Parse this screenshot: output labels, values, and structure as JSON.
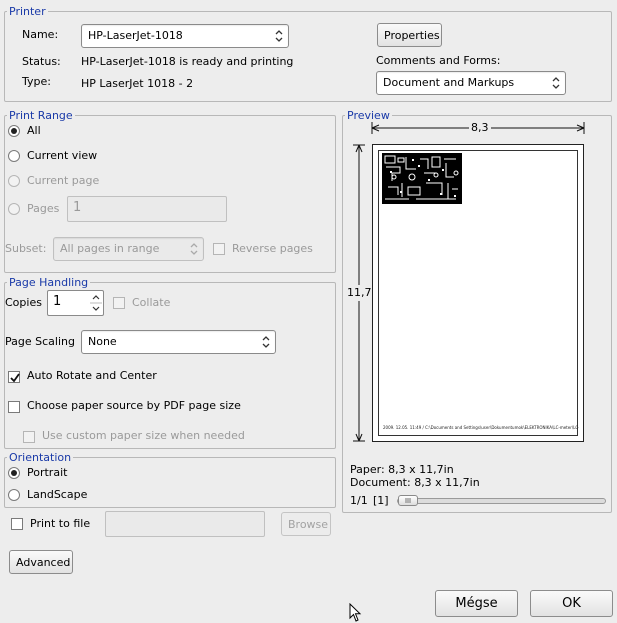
{
  "printer": {
    "group_label": "Printer",
    "name_label": "Name:",
    "name_value": "HP-LaserJet-1018",
    "status_label": "Status:",
    "status_value": "HP-LaserJet-1018 is ready and printing",
    "type_label": "Type:",
    "type_value": "HP LaserJet 1018 -  2",
    "properties_label": "Properties",
    "comments_label": "Comments and Forms:",
    "comments_value": "Document and Markups"
  },
  "print_range": {
    "group_label": "Print Range",
    "all_label": "All",
    "current_view_label": "Current view",
    "current_page_label": "Current page",
    "pages_label": "Pages",
    "pages_value": "1",
    "subset_label": "Subset:",
    "subset_value": "All pages in range",
    "reverse_label": "Reverse pages"
  },
  "page_handling": {
    "group_label": "Page Handling",
    "copies_label": "Copies",
    "copies_value": "1",
    "collate_label": "Collate",
    "scaling_label": "Page Scaling",
    "scaling_value": "None",
    "auto_rotate_label": "Auto Rotate and Center",
    "paper_source_label": "Choose paper source by PDF page size",
    "custom_size_label": "Use custom paper size when needed"
  },
  "orientation": {
    "group_label": "Orientation",
    "portrait_label": "Portrait",
    "landscape_label": "LandScape"
  },
  "print_to_file_label": "Print to file",
  "browse_label": "Browse",
  "advanced_label": "Advanced",
  "preview": {
    "group_label": "Preview",
    "width_label": "8,3",
    "height_label": "11,7",
    "paper_info": "Paper: 8,3 x 11,7in",
    "document_info": "Document: 8,3 x 11,7in",
    "page_counter": "1/1",
    "page_index": "[1]",
    "footer_text": "2009. 12.05. 11:49 / C:\\Documents and Settings\\user\\Dokumentumok\\ELEKTRONIKA\\LC-meter\\LC-meter_rajz.fcl.ii"
  },
  "buttons": {
    "cancel_label": "Mégse",
    "ok_label": "OK"
  },
  "colors": {
    "group_title": "#1a3aa8",
    "background": "#ededed"
  }
}
